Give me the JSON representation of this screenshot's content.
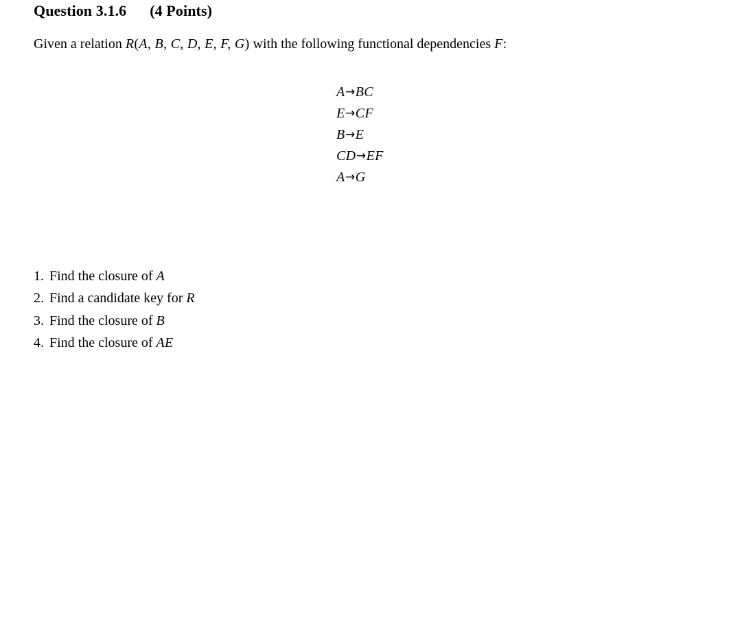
{
  "document": {
    "heading": {
      "question_label": "Question 3.1.6",
      "points_label": "(4 Points)"
    },
    "intro": {
      "before_relation": "Given a relation ",
      "relation_name": "R",
      "relation_open": "(",
      "relation_attributes": "A, B, C, D, E, F, G",
      "relation_close": ")",
      "after_relation": " with the following functional dependencies ",
      "fd_set_symbol": "F",
      "colon": ":"
    },
    "functional_dependencies": [
      {
        "lhs": "A",
        "arrow": "→",
        "rhs": "BC",
        "text": "A→BC"
      },
      {
        "lhs": "E",
        "arrow": "→",
        "rhs": "CF",
        "text": "E→CF"
      },
      {
        "lhs": "B",
        "arrow": "→",
        "rhs": "E",
        "text": "B→E"
      },
      {
        "lhs": "CD",
        "arrow": "→",
        "rhs": "EF",
        "text": "CD→EF"
      },
      {
        "lhs": "A",
        "arrow": "→",
        "rhs": "G",
        "text": "A→G"
      }
    ],
    "tasks": [
      {
        "number": "1.",
        "text": "Find the closure of ",
        "symbol": "A"
      },
      {
        "number": "2.",
        "text": "Find a candidate key for ",
        "symbol": "R"
      },
      {
        "number": "3.",
        "text": "Find the closure of ",
        "symbol": "B"
      },
      {
        "number": "4.",
        "text": "Find the closure of ",
        "symbol": "AE"
      }
    ],
    "colors": {
      "background": "#ffffff",
      "text": "#000000"
    }
  }
}
